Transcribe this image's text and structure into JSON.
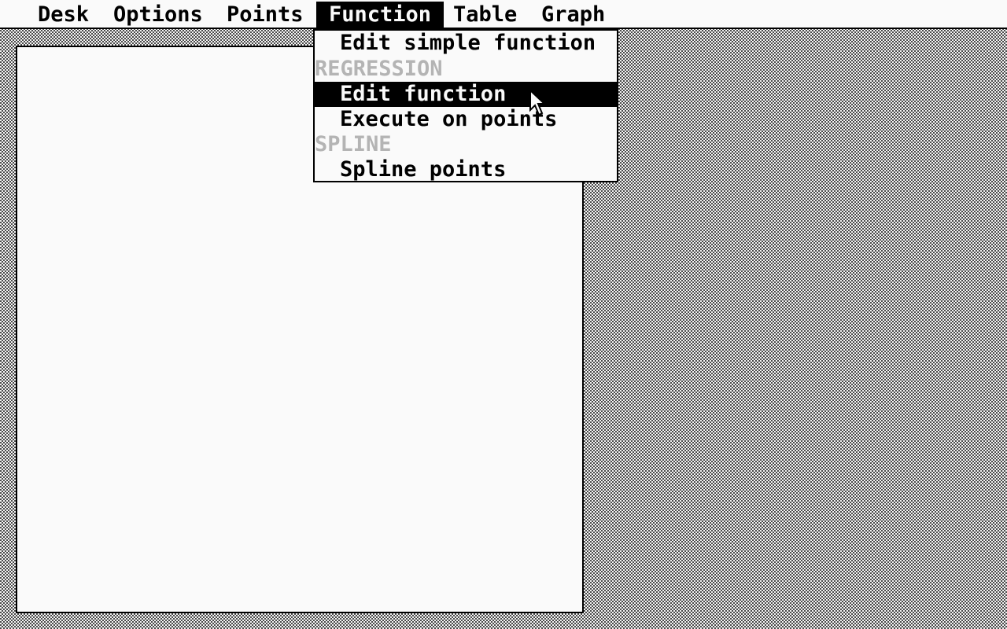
{
  "menubar": {
    "items": [
      {
        "label": "Desk"
      },
      {
        "label": "Options"
      },
      {
        "label": "Points"
      },
      {
        "label": "Function",
        "active": true
      },
      {
        "label": "Table"
      },
      {
        "label": "Graph"
      }
    ]
  },
  "function_menu": {
    "edit_simple_function": "Edit simple function",
    "regression_header": "REGRESSION",
    "edit_function": "Edit function",
    "execute_on_points": "Execute on points",
    "spline_header": "SPLINE",
    "spline_points": "Spline points",
    "highlighted": "Edit function"
  },
  "colors": {
    "background": "#fafafa",
    "foreground": "#000000",
    "disabled_text": "#b4b4b4",
    "desktop_dither": "#4a4a4a"
  },
  "icons": {
    "cursor": "arrow-pointer-icon"
  }
}
